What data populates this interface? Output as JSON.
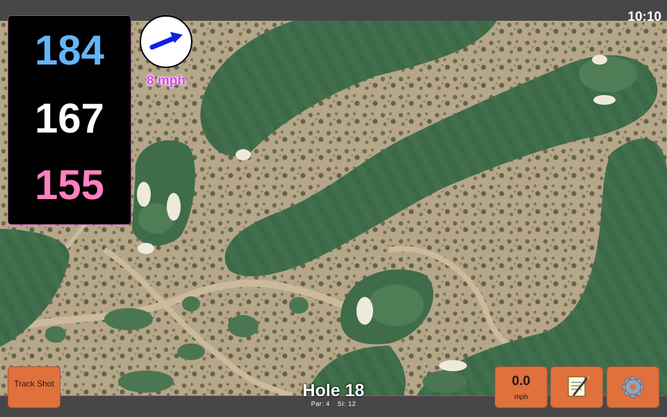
{
  "clock": "10:10",
  "yardages": {
    "back": "184",
    "middle": "167",
    "front": "155"
  },
  "wind": {
    "speed": "8 mph",
    "icon": "wind-direction-arrow-icon"
  },
  "buttons": {
    "track_shot": "Track Shot",
    "speed_value": "0.0",
    "speed_unit": "mph",
    "notes_icon": "notepad-icon",
    "settings_icon": "gear-icon"
  },
  "hole": {
    "title": "Hole 18",
    "par": "Par: 4",
    "si": "SI: 12"
  },
  "colors": {
    "accent_border": "#a0488f",
    "back_yardage": "#64b5f6",
    "middle_yardage": "#ffffff",
    "front_yardage": "#ff80c0",
    "wind_text": "#e040fb",
    "button": "#e0703c",
    "fairway": "#3d6b49",
    "sand": "#b8a88b"
  }
}
